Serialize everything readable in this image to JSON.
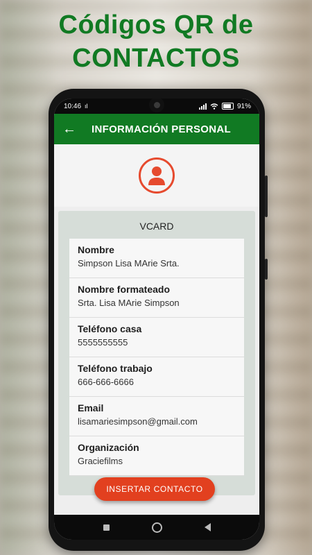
{
  "promo": {
    "title_line1": "Códigos QR de",
    "title_line2": "CONTACTOS"
  },
  "status_bar": {
    "time": "10:46",
    "battery": "91"
  },
  "app_bar": {
    "title": "INFORMACIÓN PERSONAL"
  },
  "card": {
    "title": "VCARD",
    "fields": [
      {
        "label": "Nombre",
        "value": "Simpson Lisa MArie  Srta."
      },
      {
        "label": "Nombre formateado",
        "value": "Srta. Lisa MArie Simpson"
      },
      {
        "label": "Teléfono casa",
        "value": "5555555555"
      },
      {
        "label": "Teléfono trabajo",
        "value": "666-666-6666"
      },
      {
        "label": "Email",
        "value": "lisamariesimpson@gmail.com"
      },
      {
        "label": "Organización",
        "value": "Graciefilms"
      }
    ]
  },
  "insert_button": {
    "label": "INSERTAR CONTACTO"
  },
  "colors": {
    "brand_green": "#117a23",
    "accent_orange": "#e2401f"
  }
}
